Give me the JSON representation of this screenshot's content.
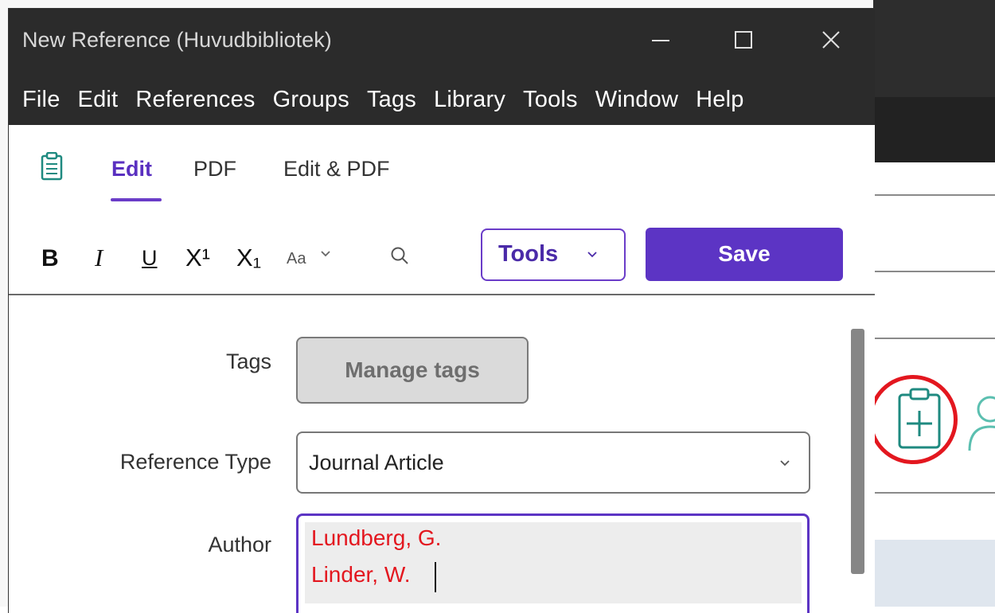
{
  "window": {
    "title": "New Reference (Huvudbibliotek)"
  },
  "menu": [
    "File",
    "Edit",
    "References",
    "Groups",
    "Tags",
    "Library",
    "Tools",
    "Window",
    "Help"
  ],
  "tabs": {
    "edit": "Edit",
    "pdf": "PDF",
    "edit_pdf": "Edit & PDF"
  },
  "toolbar": {
    "bold": "B",
    "italic": "I",
    "underline": "U",
    "superscript": "X¹",
    "subscript": "X₁",
    "font_size": "Aa",
    "tools_label": "Tools",
    "save_label": "Save"
  },
  "fields": {
    "tags_label": "Tags",
    "manage_tags": "Manage tags",
    "reference_type_label": "Reference Type",
    "reference_type_value": "Journal Article",
    "author_label": "Author",
    "authors": [
      "Lundberg, G.",
      "Linder, W."
    ]
  },
  "colors": {
    "accent": "#5c34c4",
    "highlight": "#e3171f",
    "teal_icon": "#1f8a80"
  },
  "icons": [
    "clipboard-icon",
    "search-icon",
    "chevron-down-icon",
    "add-reference-icon",
    "person-icon"
  ]
}
